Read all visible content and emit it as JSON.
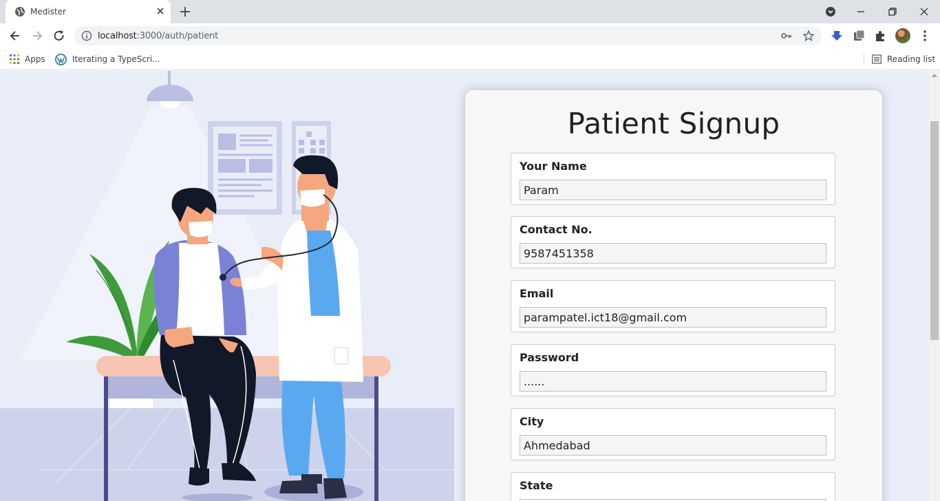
{
  "browser": {
    "tab_title": "Medister",
    "url_host": "localhost",
    "url_path": ":3000/auth/patient",
    "bookmarks": [
      {
        "label": "Apps",
        "icon": "apps-grid-icon"
      },
      {
        "label": "Iterating a TypeScri...",
        "icon": "wordpress-icon"
      }
    ],
    "reading_list": "Reading list"
  },
  "form": {
    "title": "Patient Signup",
    "fields": [
      {
        "label": "Your Name",
        "value": "Param",
        "type": "text"
      },
      {
        "label": "Contact No.",
        "value": "9587451358",
        "type": "text"
      },
      {
        "label": "Email",
        "value": "parampatel.ict18@gmail.com",
        "type": "text"
      },
      {
        "label": "Password",
        "value": "......",
        "type": "password"
      },
      {
        "label": "City",
        "value": "Ahmedabad",
        "type": "text"
      },
      {
        "label": "State",
        "value": "",
        "type": "text"
      }
    ]
  },
  "colors": {
    "page_bg": "#e9edf8",
    "floor": "#cdd3ea",
    "coat": "#ffffff",
    "scrubs": "#5aa9f0",
    "jacket": "#7b82d6",
    "couch": "#f8c5b3",
    "plant": "#3d9b3a"
  }
}
